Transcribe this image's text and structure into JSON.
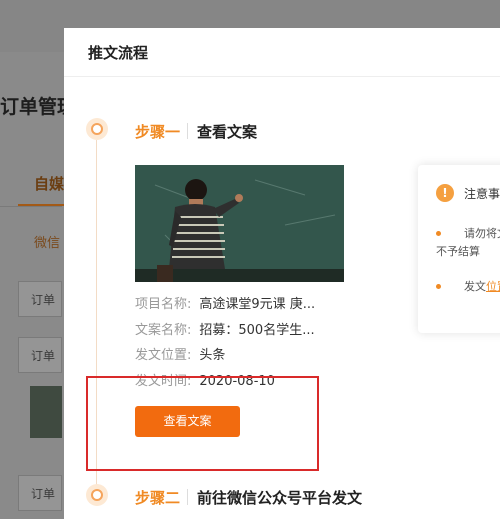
{
  "background": {
    "page_title": "订单管理",
    "active_tab": "自媒",
    "sub_tab": "微信",
    "card_labels": [
      "订单",
      "订单",
      "订单"
    ]
  },
  "modal": {
    "title": "推文流程",
    "step1": {
      "label": "步骤一",
      "title": "查看文案",
      "info": [
        {
          "key": "项目名称:",
          "value": "高途课堂9元课 庚..."
        },
        {
          "key": "文案名称:",
          "value": "招募：500名学生..."
        },
        {
          "key": "发文位置:",
          "value": "头条"
        },
        {
          "key": "发文时间:",
          "value": "2020-08-10"
        }
      ],
      "button": "查看文案"
    },
    "step2": {
      "label": "步骤二",
      "title": "前往微信公众号平台发文"
    },
    "notice": {
      "icon": "!",
      "title": "注意事",
      "line1": "请勿将文",
      "line2": "不予结算",
      "line3_prefix": "发文",
      "line3_link": "位置"
    }
  },
  "colors": {
    "accent": "#f08a24",
    "button": "#f26b0f",
    "highlight": "#d92a2a"
  }
}
